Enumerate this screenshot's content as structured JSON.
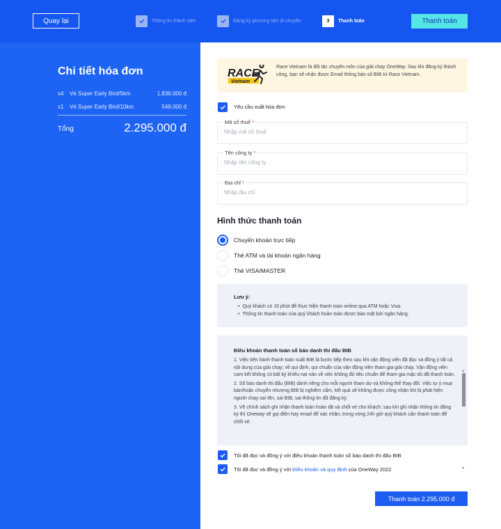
{
  "header": {
    "back_label": "Quay lại",
    "steps": [
      {
        "label": "Thông tin thành viên",
        "state": "done"
      },
      {
        "label": "Đăng ký phương tiện di chuyển",
        "state": "done"
      },
      {
        "number": "3",
        "label": "Thanh toán",
        "state": "current"
      }
    ],
    "pay_label": "Thanh toán"
  },
  "invoice": {
    "title": "Chi tiết hóa đơn",
    "items": [
      {
        "qty": "x4",
        "name": "Vé Super Early Bird/5km",
        "price": "1.836.000 đ"
      },
      {
        "qty": "x1",
        "name": "Vé Super Early Bird/10km",
        "price": "549.000 đ"
      }
    ],
    "total_label": "Tổng",
    "total_value": "2.295.000 đ"
  },
  "partner": {
    "logo_text": "RACE",
    "logo_subtext": "Vietnam",
    "text": "Race Vietnam là đối tác chuyên môn của giải chạy OneWay. Sau khi đăng ký thành công, bạn sẽ nhận được Email thông báo số BIB từ Race Vietnam."
  },
  "invoice_request": {
    "label": "Yêu cầu xuất hóa đơn",
    "checked": true
  },
  "fields": [
    {
      "label": "Mã số thuế",
      "required": "*",
      "placeholder": "Nhập mã số thuế",
      "value": ""
    },
    {
      "label": "Tên công ty",
      "required": "*",
      "placeholder": "Nhập tên công ty",
      "value": ""
    },
    {
      "label": "Địa chỉ",
      "required": "*",
      "placeholder": "Nhập địa chỉ",
      "value": ""
    }
  ],
  "payment": {
    "title": "Hình thức thanh toán",
    "options": [
      {
        "label": "Chuyển khoản trực tiếp",
        "selected": true
      },
      {
        "label": "Thẻ ATM và tài khoản ngân hàng",
        "selected": false
      },
      {
        "label": "Thẻ VISA/MASTER",
        "selected": false
      }
    ]
  },
  "note": {
    "title": "Lưu ý:",
    "items": [
      "Quý khách có 15 phút để thực hiện thanh toán online qua ATM hoặc Visa.",
      "Thông tin thanh toán của quý khách hoàn toàn được bảo mật bởi ngân hàng."
    ]
  },
  "terms": {
    "title": "Điều khoản thanh toán số báo danh thi đấu BIB",
    "paragraphs": [
      "1. Việc tiến hành thanh toán suất BIB là bước tiếp theo sau khi vận động viên đã đọc và đồng ý tất cả nội dung của giải chạy; về qui định, qui chuẩn của vận động viên tham gia giải chạy. Vận động viên cam kết không có bất kỳ khiếu nại nào về việc không đủ tiêu chuẩn để tham gia mặc dù đã thanh toán.",
      "2. Số báo danh thi đấu (BIB) dành riêng cho mỗi người tham dự và không thể thay đổi. Việc tự ý mua bán/hoặc chuyển nhượng BIB bị nghiêm cấm, kết quả sẽ không được công nhận khi bị phát hiện người chạy sai tên, sai BIB, sai thông tin đã đăng ký.",
      "3. Về chính sách ghi nhận thanh toán hoàn tất và chốt vé cho khách: sau khi ghi nhận thông tin đăng ký thì Oneway sẽ gọi điện hay email để xác nhận; trong vòng 24h giờ quý khách cần thanh toán để chốt vé."
    ],
    "agree_terms_label": "Tôi đã đọc và đồng ý với điều khoản thanh toán số báo danh thi đấu BIB",
    "agree_policy_prefix": "Tôi đã đọc và đồng ý với ",
    "agree_policy_link": "Điều khoản và quy định",
    "agree_policy_suffix": " của OneWay 2022"
  },
  "submit": {
    "label": "Thanh toán 2.295.000 đ"
  },
  "colors": {
    "header_bg": "#1656f0",
    "panel_bg": "#1d63f4",
    "accent": "#1d5cf0",
    "cta_top": "#54e6e6"
  }
}
